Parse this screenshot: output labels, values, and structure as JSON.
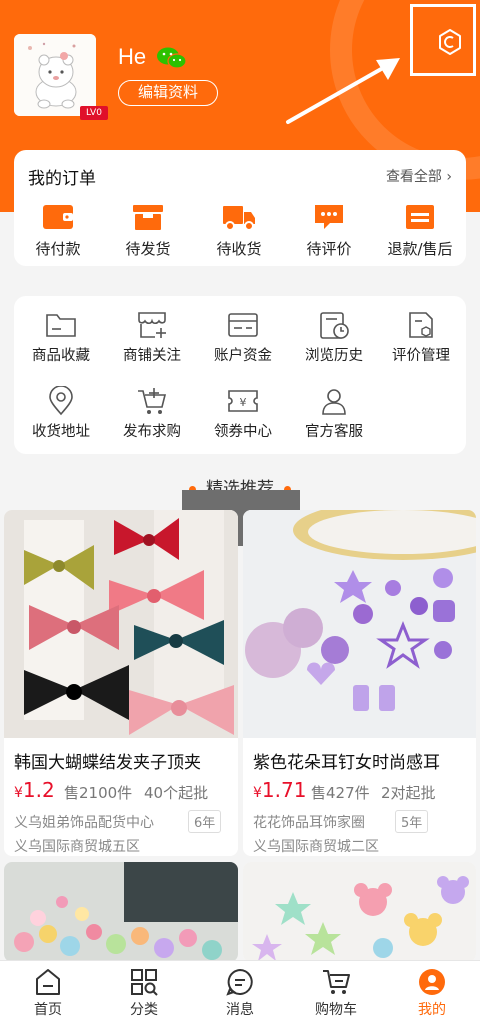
{
  "profile": {
    "username": "He",
    "level": "LV0",
    "edit_label": "编辑资料"
  },
  "orders": {
    "title": "我的订单",
    "view_all": "查看全部",
    "items": [
      {
        "label": "待付款",
        "icon": "wallet-icon"
      },
      {
        "label": "待发货",
        "icon": "package-icon"
      },
      {
        "label": "待收货",
        "icon": "truck-icon"
      },
      {
        "label": "待评价",
        "icon": "comment-icon"
      },
      {
        "label": "退款/售后",
        "icon": "refund-icon"
      }
    ]
  },
  "tools": [
    {
      "label": "商品收藏",
      "icon": "folder-icon"
    },
    {
      "label": "商铺关注",
      "icon": "shop-follow-icon"
    },
    {
      "label": "账户资金",
      "icon": "card-icon"
    },
    {
      "label": "浏览历史",
      "icon": "history-icon"
    },
    {
      "label": "评价管理",
      "icon": "review-manage-icon"
    },
    {
      "label": "收货地址",
      "icon": "location-icon"
    },
    {
      "label": "发布求购",
      "icon": "cart-publish-icon"
    },
    {
      "label": "领券中心",
      "icon": "coupon-icon"
    },
    {
      "label": "官方客服",
      "icon": "service-icon"
    }
  ],
  "section": {
    "title": "精选推荐"
  },
  "products": [
    {
      "title": "韩国大蝴蝶结发夹子顶夹",
      "currency": "¥",
      "price": "1.2",
      "sales": "售2100件",
      "moq": "40个起批",
      "shop": "义乌姐弟饰品配货中心",
      "years": "6年",
      "address": "义乌国际商贸城五区"
    },
    {
      "title": "紫色花朵耳钉女时尚感耳",
      "currency": "¥",
      "price": "1.71",
      "sales": "售427件",
      "moq": "2对起批",
      "shop": "花花饰品耳饰家圈",
      "years": "5年",
      "address": "义乌国际商贸城二区"
    }
  ],
  "tabbar": [
    {
      "label": "首页",
      "icon": "home-icon"
    },
    {
      "label": "分类",
      "icon": "category-icon"
    },
    {
      "label": "消息",
      "icon": "message-icon"
    },
    {
      "label": "购物车",
      "icon": "cart-icon"
    },
    {
      "label": "我的",
      "icon": "me-icon",
      "active": true
    }
  ],
  "colors": {
    "brand": "#ff6a0c",
    "price": "#e8102a"
  }
}
